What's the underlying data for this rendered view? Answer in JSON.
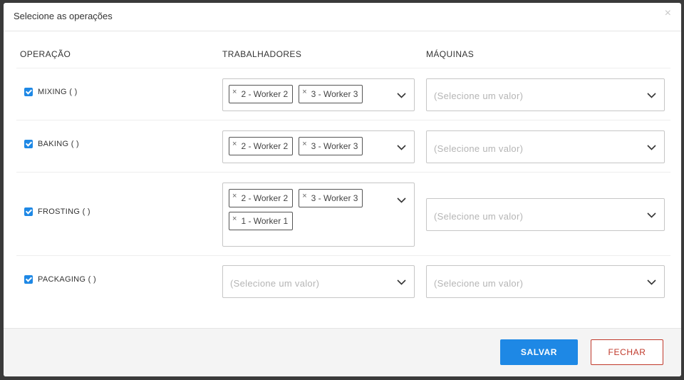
{
  "modal": {
    "title": "Selecione as operações",
    "close_glyph": "×"
  },
  "table": {
    "headers": {
      "operation": "OPERAÇÃO",
      "workers": "TRABALHADORES",
      "machines": "MÁQUINAS"
    },
    "placeholder": "(Selecione um valor)",
    "rows": [
      {
        "operation": "MIXING ( )",
        "checked": true,
        "workers": [
          "2 - Worker 2",
          "3 - Worker 3"
        ],
        "machines": []
      },
      {
        "operation": "BAKING ( )",
        "checked": true,
        "workers": [
          "2 - Worker 2",
          "3 - Worker 3"
        ],
        "machines": []
      },
      {
        "operation": "FROSTING ( )",
        "checked": true,
        "workers": [
          "2 - Worker 2",
          "3 - Worker 3",
          "1 - Worker 1"
        ],
        "machines": []
      },
      {
        "operation": "PACKAGING ( )",
        "checked": true,
        "workers": [],
        "machines": []
      }
    ]
  },
  "tag_remove_glyph": "×",
  "footer": {
    "save_label": "SALVAR",
    "close_label": "FECHAR"
  },
  "colors": {
    "accent": "#1e88e5",
    "danger": "#c0392b"
  },
  "icons": {
    "dropdown": "chevron-down-icon",
    "checkbox": "checkbox-checked-icon",
    "remove": "close-icon"
  }
}
